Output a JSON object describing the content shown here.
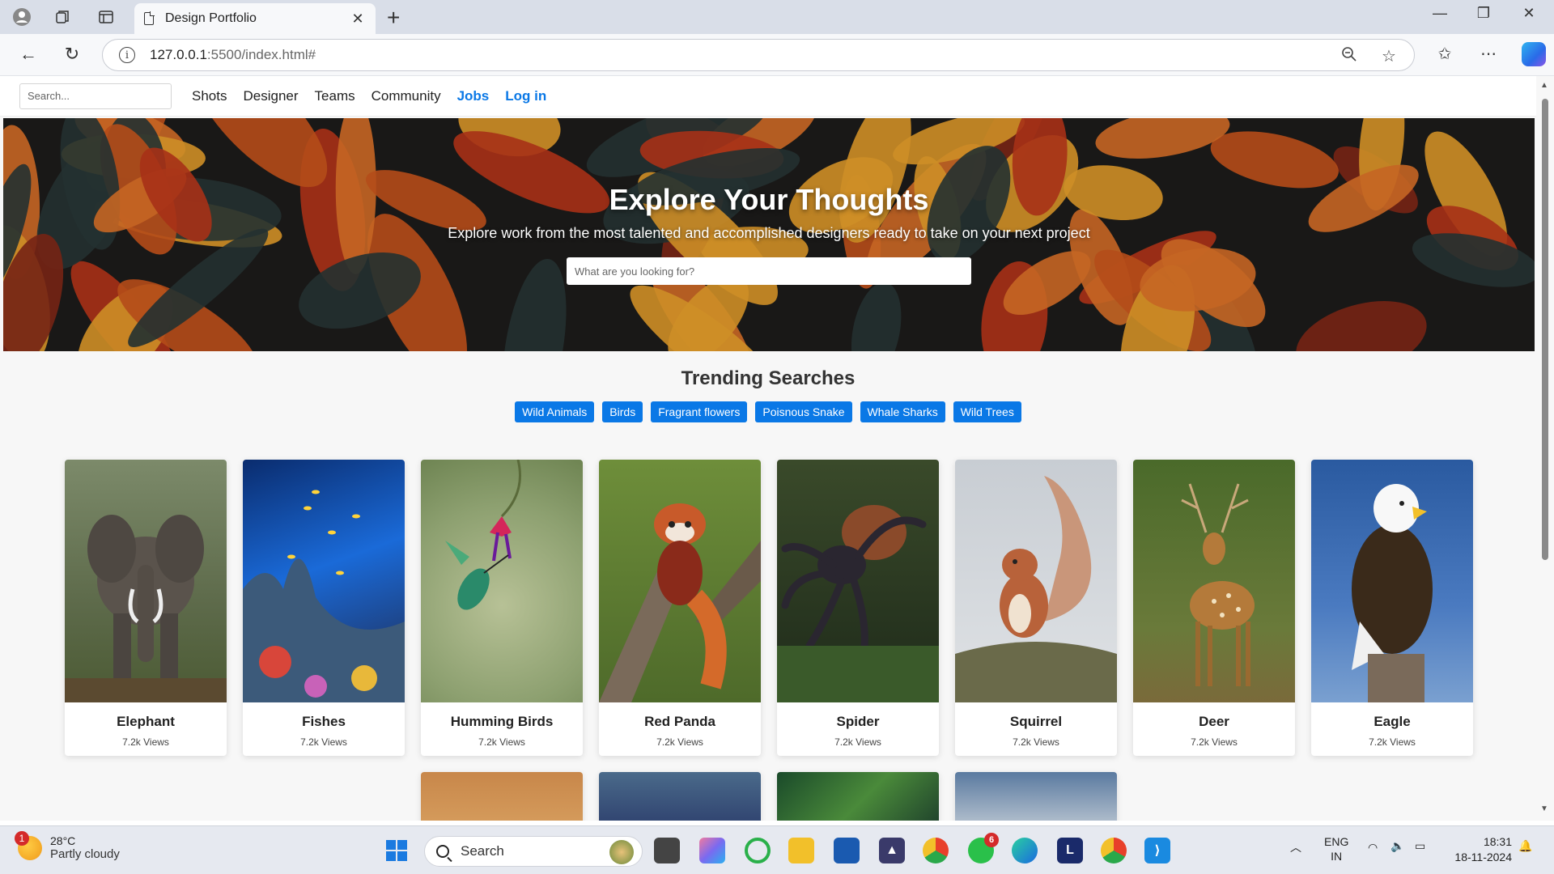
{
  "browser": {
    "tab_title": "Design Portfolio",
    "url_host": "127.0.0.1",
    "url_path": ":5500/index.html#"
  },
  "nav": {
    "search_placeholder": "Search...",
    "links": [
      "Shots",
      "Designer",
      "Teams",
      "Community"
    ],
    "jobs": "Jobs",
    "login": "Log in"
  },
  "hero": {
    "title": "Explore Your Thoughts",
    "subtitle": "Explore work from the most talented and accomplished designers ready to take on your next project",
    "search_placeholder": "What are you looking for?"
  },
  "trending": {
    "heading": "Trending Searches",
    "tags": [
      "Wild Animals",
      "Birds",
      "Fragrant flowers",
      "Poisnous Snake",
      "Whale Sharks",
      "Wild Trees"
    ]
  },
  "cards": [
    {
      "name": "Elephant",
      "views": "7.2k Views"
    },
    {
      "name": "Fishes",
      "views": "7.2k Views"
    },
    {
      "name": "Humming Birds",
      "views": "7.2k Views"
    },
    {
      "name": "Red Panda",
      "views": "7.2k Views"
    },
    {
      "name": "Spider",
      "views": "7.2k Views"
    },
    {
      "name": "Squirrel",
      "views": "7.2k Views"
    },
    {
      "name": "Deer",
      "views": "7.2k Views"
    },
    {
      "name": "Eagle",
      "views": "7.2k Views"
    }
  ],
  "taskbar": {
    "weather_temp": "28°C",
    "weather_desc": "Partly cloudy",
    "weather_badge": "1",
    "search": "Search",
    "whatsapp_badge": "6",
    "lang1": "ENG",
    "lang2": "IN",
    "time": "18:31",
    "date": "18-11-2024"
  },
  "colors": {
    "accent": "#0a78e6",
    "hero_leaf_orange": "#e8782a",
    "hero_leaf_red": "#c43a1c",
    "hero_leaf_yellow": "#f2a72e"
  }
}
